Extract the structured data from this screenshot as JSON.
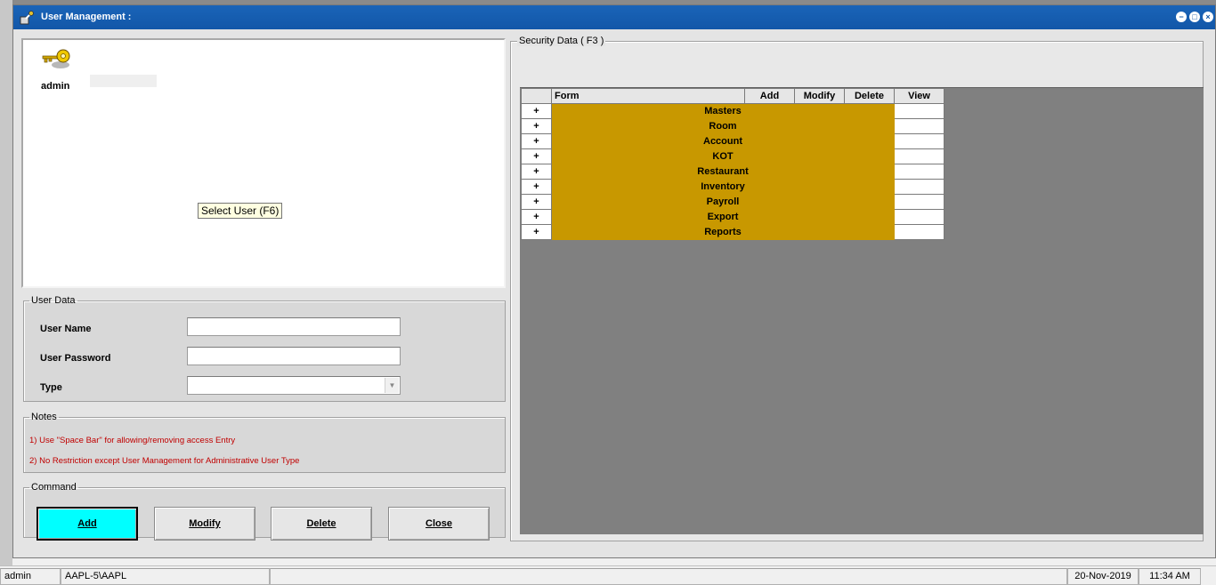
{
  "window": {
    "title": "User Management :"
  },
  "users": [
    {
      "name": "admin"
    }
  ],
  "tooltip": "Select User (F6)",
  "user_data": {
    "legend": "User Data",
    "user_name_label": "User Name",
    "user_name_value": "",
    "password_label": "User Password",
    "password_value": "",
    "type_label": "Type",
    "type_value": ""
  },
  "notes": {
    "legend": "Notes",
    "items": [
      "1)  Use \"Space Bar\" for allowing/removing access Entry",
      "2)  No Restriction except User Management for Administrative User Type"
    ]
  },
  "command": {
    "legend": "Command",
    "add": "Add",
    "modify": "Modify",
    "delete": "Delete",
    "close": "Close"
  },
  "security": {
    "legend": "Security Data ( F3 )",
    "headers": {
      "form": "Form",
      "add": "Add",
      "modify": "Modify",
      "delete": "Delete",
      "view": "View"
    },
    "expand_symbol": "+",
    "rows": [
      "Masters",
      "Room",
      "Account",
      "KOT",
      "Restaurant",
      "Inventory",
      "Payroll",
      "Export",
      "Reports"
    ]
  },
  "status": {
    "user": "admin",
    "machine": "AAPL-5\\AAPL",
    "date": "20-Nov-2019",
    "time": "11:34 AM"
  },
  "colors": {
    "title_bar": "#1257a8",
    "row_highlight": "#c89800",
    "active_button": "#00ffff",
    "note_text": "#c00000"
  }
}
